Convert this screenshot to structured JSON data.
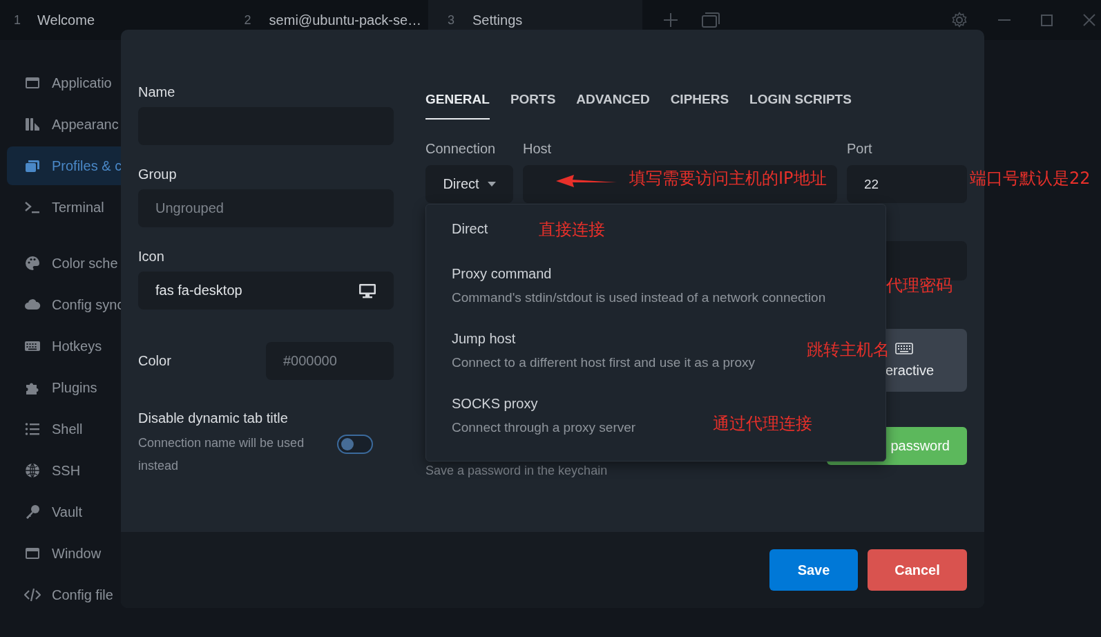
{
  "tab_bar": {
    "tabs": [
      {
        "number": "1",
        "label": "Welcome",
        "selected": false
      },
      {
        "number": "2",
        "label": "semi@ubuntu-pack-se…",
        "selected": false
      },
      {
        "number": "3",
        "label": "Settings",
        "selected": true
      }
    ]
  },
  "sidebar": {
    "sections": [
      {
        "items": [
          {
            "label": "Applicatio",
            "selected": false
          },
          {
            "label": "Appearanc",
            "selected": false
          },
          {
            "label": "Profiles & c",
            "selected": true
          },
          {
            "label": "Terminal",
            "selected": false
          }
        ]
      },
      {
        "items": [
          {
            "label": "Color sche",
            "selected": false
          },
          {
            "label": "Config sync",
            "selected": false
          },
          {
            "label": "Hotkeys",
            "selected": false
          },
          {
            "label": "Plugins",
            "selected": false
          },
          {
            "label": "Shell",
            "selected": false
          },
          {
            "label": "SSH",
            "selected": false
          },
          {
            "label": "Vault",
            "selected": false
          },
          {
            "label": "Window",
            "selected": false
          },
          {
            "label": "Config file",
            "selected": false
          }
        ]
      }
    ]
  },
  "dialog": {
    "name": {
      "label": "Name"
    },
    "group": {
      "label": "Group",
      "placeholder": "Ungrouped"
    },
    "icon": {
      "label": "Icon",
      "value": "fas fa-desktop"
    },
    "color": {
      "label": "Color",
      "placeholder": "#000000"
    },
    "dynamic_title": {
      "title": "Disable dynamic tab title",
      "description": "Connection name will be used instead",
      "on": false
    },
    "tabs": [
      {
        "label": "GENERAL",
        "selected": true
      },
      {
        "label": "PORTS",
        "selected": false
      },
      {
        "label": "ADVANCED",
        "selected": false
      },
      {
        "label": "CIPHERS",
        "selected": false
      },
      {
        "label": "LOGIN SCRIPTS",
        "selected": false
      }
    ],
    "connection": {
      "label": "Connection",
      "value": "Direct",
      "expanded": true
    },
    "host": {
      "label": "Host"
    },
    "port": {
      "label": "Port",
      "value": "22"
    },
    "connection_menu": [
      {
        "title": "Direct"
      },
      {
        "title": "Proxy command",
        "description": "Command's stdin/stdout is used instead of a network connection"
      },
      {
        "title": "Jump host",
        "description": "Connect to a different host first and use it as a proxy"
      },
      {
        "title": "SOCKS proxy",
        "description": "Connect through a proxy server"
      }
    ],
    "auth_button": {
      "label": "eractive"
    },
    "keychain_hint": "Save a password in the keychain",
    "password_button": {
      "label": "password"
    },
    "buttons": [
      {
        "label": "Save",
        "kind": "primary"
      },
      {
        "label": "Cancel",
        "kind": "danger"
      }
    ]
  },
  "annotations": [
    {
      "text": "填写需要访问主机的IP地址"
    },
    {
      "text": "端口号默认是22"
    },
    {
      "text": "直接连接"
    },
    {
      "text": "代理密码"
    },
    {
      "text": "跳转主机名"
    },
    {
      "text": "通过代理连接"
    }
  ]
}
